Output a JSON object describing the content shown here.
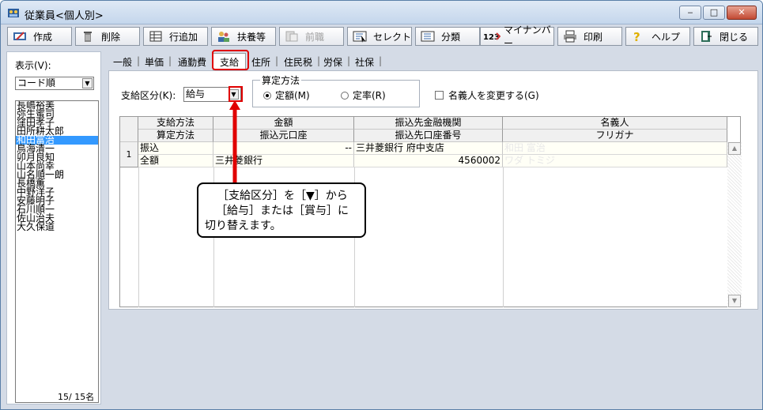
{
  "window": {
    "title": "従業員<個人別>",
    "controls": {
      "minimize": "‒",
      "maximize": "□",
      "close": "✕"
    }
  },
  "toolbar": [
    {
      "key": "create",
      "label": "作成",
      "icon": "create-icon",
      "enabled": true
    },
    {
      "key": "delete",
      "label": "削除",
      "icon": "trash-icon",
      "enabled": true
    },
    {
      "key": "add_row",
      "label": "行追加",
      "icon": "add-row-icon",
      "enabled": true
    },
    {
      "key": "dependents",
      "label": "扶養等",
      "icon": "dependents-icon",
      "enabled": true
    },
    {
      "key": "prev_job",
      "label": "前職",
      "icon": "prev-job-icon",
      "enabled": false
    },
    {
      "key": "select",
      "label": "セレクト",
      "icon": "select-icon",
      "enabled": true
    },
    {
      "key": "category",
      "label": "分類",
      "icon": "category-icon",
      "enabled": true
    },
    {
      "key": "my_number",
      "label": "マイナンバー",
      "icon": "my-number-icon",
      "enabled": true
    },
    {
      "key": "print",
      "label": "印刷",
      "icon": "printer-icon",
      "enabled": true
    },
    {
      "key": "help",
      "label": "ヘルプ",
      "icon": "help-icon",
      "enabled": true
    },
    {
      "key": "close",
      "label": "閉じる",
      "icon": "close-book-icon",
      "enabled": true
    }
  ],
  "left_panel": {
    "display_label": "表示(V):",
    "sort_value": "コード順",
    "employees": [
      "長嶋裕美",
      "弥生蜜司",
      "窪田孝子",
      "田所耕太郎",
      "和田富治",
      "鳥海清一",
      "卯月良知",
      "山本尚幸",
      "山名順一朗",
      "長橋薫",
      "中野洋子",
      "安藤明子",
      "石川順一",
      "佐山治夫",
      "大久保道"
    ],
    "selected_index": 4,
    "count_text": "15/  15名"
  },
  "tabs": [
    {
      "label": "一般",
      "active": false
    },
    {
      "label": "単価",
      "active": false
    },
    {
      "label": "通勤費",
      "active": false
    },
    {
      "label": "支給",
      "active": true
    },
    {
      "label": "住所",
      "active": false
    },
    {
      "label": "住民税",
      "active": false
    },
    {
      "label": "労保",
      "active": false
    },
    {
      "label": "社保",
      "active": false
    }
  ],
  "form": {
    "pay_type_label": "支給区分(K):",
    "pay_type_value": "給与",
    "calc_method_legend": "算定方法",
    "radio_fixed": "定額(M)",
    "radio_rate": "定率(R)",
    "radio_selected": "fixed",
    "change_name_label": "名義人を変更する(G)",
    "change_name_checked": false
  },
  "grid": {
    "headers_row1": [
      "支給方法",
      "金額",
      "振込先金融機関",
      "名義人"
    ],
    "headers_row2": [
      "算定方法",
      "振込元口座",
      "振込先口座番号",
      "フリガナ"
    ],
    "rows": [
      {
        "num": "1",
        "line1": [
          "振込",
          "--",
          "三井菱銀行 府中支店",
          "和田 富治"
        ],
        "line2": [
          "全額",
          "三井菱銀行",
          "4560002",
          "ワダ トミジ"
        ]
      }
    ]
  },
  "callout": {
    "line1": "［支給区分］を［▼］から",
    "line2": "［給与］または［賞与］に",
    "line3": "切り替えます。"
  },
  "colors": {
    "highlight": "#e00000",
    "selection": "#3399ff"
  }
}
